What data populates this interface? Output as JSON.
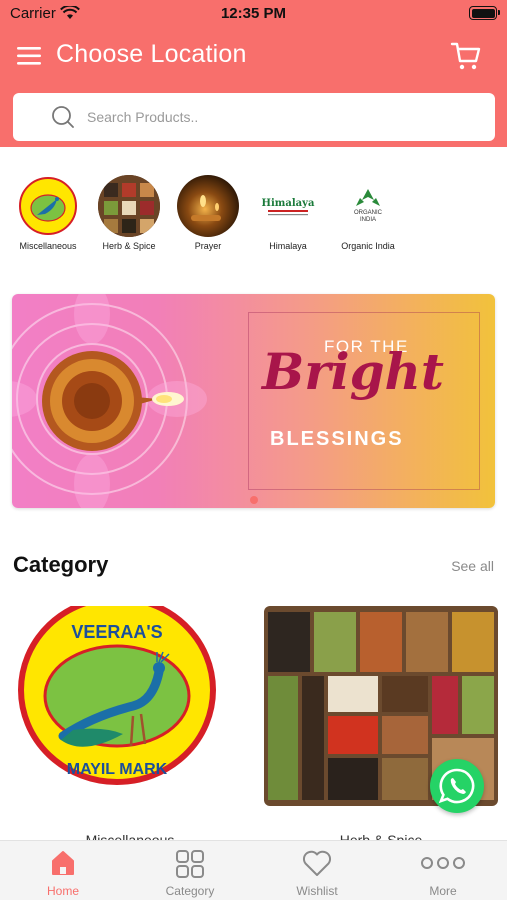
{
  "status_bar": {
    "carrier": "Carrier",
    "time": "12:35 PM"
  },
  "header": {
    "title": "Choose Location",
    "menu_icon": "hamburger-menu-icon",
    "cart_icon": "cart-icon",
    "bg_color": "#f86f6c"
  },
  "search": {
    "placeholder": "Search Products.."
  },
  "brands": [
    {
      "label": "Miscellaneous",
      "logo_text": "VEERAA'S"
    },
    {
      "label": "Herb & Spice"
    },
    {
      "label": "Prayer"
    },
    {
      "label": "Himalaya",
      "logo_text": "Himalaya"
    },
    {
      "label": "Organic India",
      "logo_text": "ORGANIC INDIA"
    }
  ],
  "banner": {
    "line1": "FOR THE",
    "line2": "Bright",
    "line3": "BLESSINGS",
    "active_slide": 1,
    "slide_count": 1
  },
  "category_section": {
    "title": "Category",
    "see_all": "See all",
    "items": [
      {
        "label": "Miscellaneous",
        "logo_top": "VEERAA'S",
        "logo_bottom": "MAYIL MARK"
      },
      {
        "label": "Herb & Spice"
      }
    ]
  },
  "floating": {
    "icon": "whatsapp-icon"
  },
  "tabbar": {
    "active_color": "#f86f6c",
    "tabs": [
      {
        "label": "Home",
        "icon": "home-icon",
        "active": true
      },
      {
        "label": "Category",
        "icon": "grid-icon",
        "active": false
      },
      {
        "label": "Wishlist",
        "icon": "heart-icon",
        "active": false
      },
      {
        "label": "More",
        "icon": "more-dots-icon",
        "active": false
      }
    ]
  }
}
